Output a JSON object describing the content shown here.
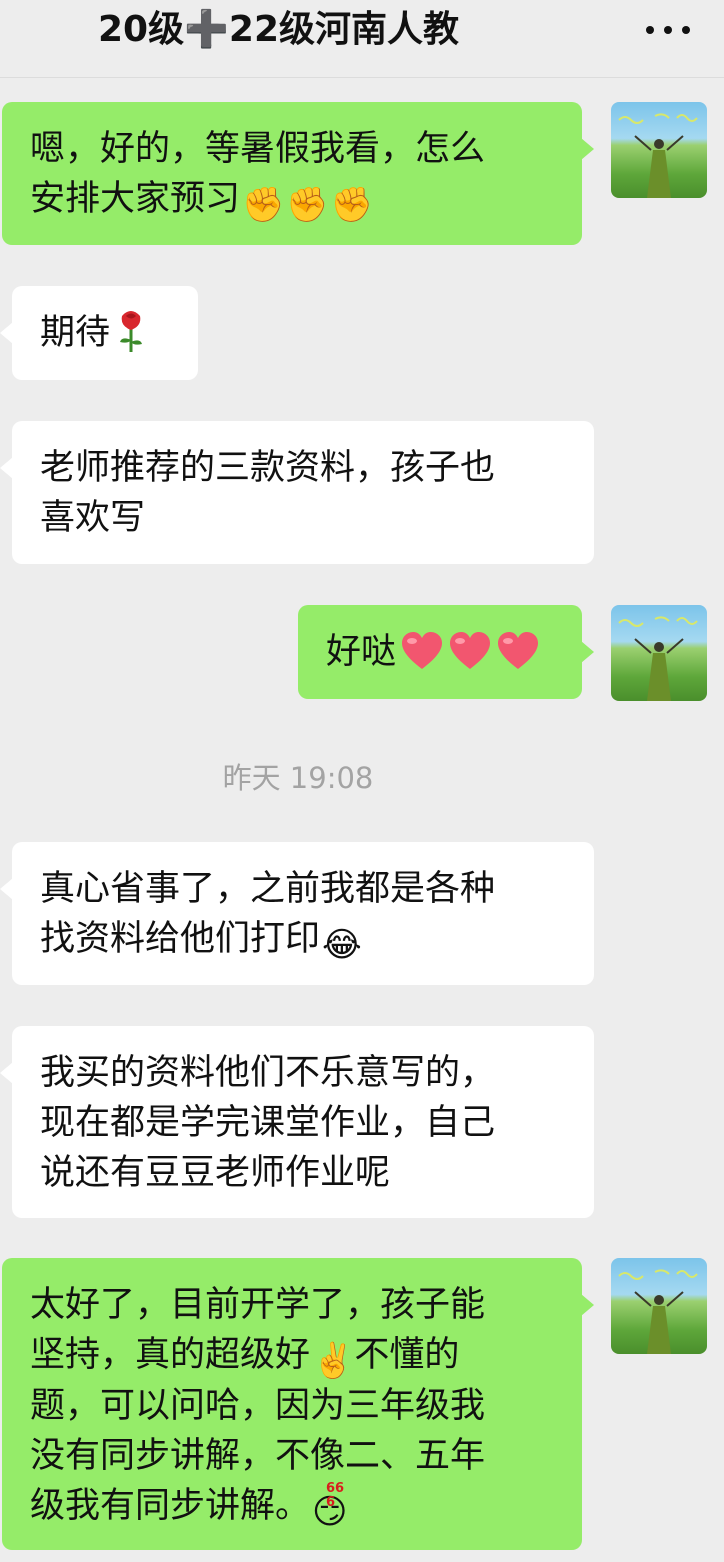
{
  "header": {
    "title": "20级➕22级河南人教",
    "more_icon": "more-dots-icon"
  },
  "messages": [
    {
      "direction": "out",
      "lines": [
        "嗯，好的，等暑假我看，怎么",
        "安排大家预习"
      ],
      "emoji": [
        "✊",
        "✊",
        "✊"
      ]
    },
    {
      "direction": "in",
      "text": "期待",
      "icon": "rose-icon"
    },
    {
      "direction": "in",
      "lines": [
        "老师推荐的三款资料，孩子也",
        "喜欢写"
      ]
    },
    {
      "direction": "out",
      "text": "好哒",
      "icons": [
        "heart-icon",
        "heart-icon",
        "heart-icon"
      ]
    },
    {
      "direction": "in",
      "lines": [
        "真心省事了，之前我都是各种",
        "找资料给他们打印"
      ],
      "emoji": [
        "😂"
      ]
    },
    {
      "direction": "in",
      "lines": [
        "我买的资料他们不乐意写的，",
        "现在都是学完课堂作业，自己",
        "说还有豆豆老师作业呢"
      ]
    },
    {
      "direction": "out",
      "lines": [
        "太好了，目前开学了，孩子能",
        "坚持，真的超级好",
        "题，可以问哈，因为三年级我",
        "没有同步讲解，不像二、五年",
        "级我有同步讲解。"
      ],
      "inline_emoji": "✌️",
      "line2_tail": "不懂的",
      "end_emoji": "😏",
      "badge": "666"
    }
  ],
  "timestamp": "昨天 19:08",
  "colors": {
    "background": "#ededed",
    "outgoing_bubble": "#95ec69",
    "incoming_bubble": "#ffffff",
    "timestamp_text": "#a3a3a3"
  },
  "avatar": {
    "icon": "user-avatar-icon"
  }
}
